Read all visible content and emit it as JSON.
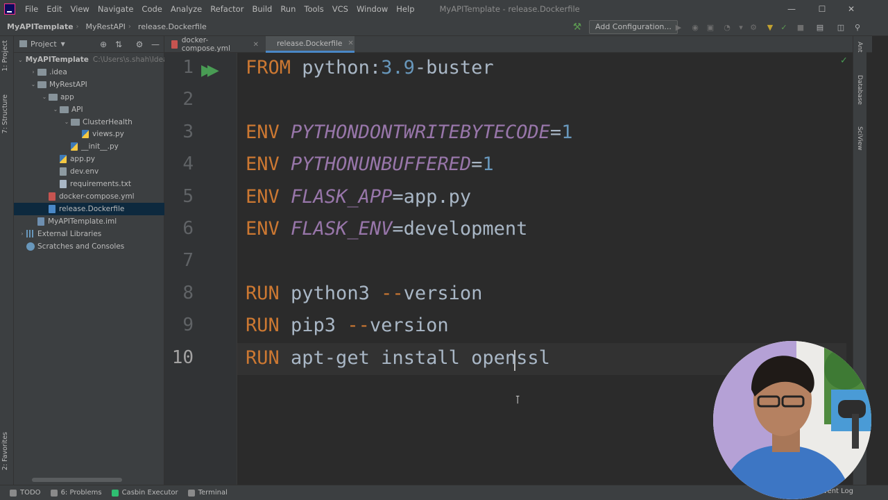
{
  "menu": {
    "items": [
      "File",
      "Edit",
      "View",
      "Navigate",
      "Code",
      "Analyze",
      "Refactor",
      "Build",
      "Run",
      "Tools",
      "VCS",
      "Window",
      "Help"
    ],
    "window_title": "MyAPITemplate - release.Dockerfile"
  },
  "breadcrumb": [
    "MyAPITemplate",
    "MyRestAPI",
    "release.Dockerfile"
  ],
  "toolbar": {
    "add_configuration": "Add Configuration..."
  },
  "left_strip": {
    "project_tab": "1: Project",
    "structure_tab": "7: Structure",
    "favorites_tab": "2: Favorites"
  },
  "right_strip": {
    "ant_tab": "Ant",
    "database_tab": "Database",
    "sciview_tab": "SciView"
  },
  "project_panel": {
    "title": "Project",
    "tree": [
      {
        "label": "MyAPITemplate",
        "hint": "C:\\Users\\s.shah\\Idea",
        "kind": "module",
        "depth": 0,
        "expanded": true
      },
      {
        "label": ".idea",
        "kind": "folder",
        "depth": 1,
        "expanded": false
      },
      {
        "label": "MyRestAPI",
        "kind": "folder",
        "depth": 1,
        "expanded": true
      },
      {
        "label": "app",
        "kind": "folder",
        "depth": 2,
        "expanded": true
      },
      {
        "label": "API",
        "kind": "folder",
        "depth": 3,
        "expanded": true
      },
      {
        "label": "ClusterHealth",
        "kind": "folder",
        "depth": 4,
        "expanded": true
      },
      {
        "label": "views.py",
        "kind": "py",
        "depth": 5
      },
      {
        "label": "__init__.py",
        "kind": "py",
        "depth": 4
      },
      {
        "label": "app.py",
        "kind": "py",
        "depth": 3
      },
      {
        "label": "dev.env",
        "kind": "env",
        "depth": 3
      },
      {
        "label": "requirements.txt",
        "kind": "txt",
        "depth": 3
      },
      {
        "label": "docker-compose.yml",
        "kind": "yml",
        "depth": 2
      },
      {
        "label": "release.Dockerfile",
        "kind": "docker",
        "depth": 2,
        "selected": true
      },
      {
        "label": "MyAPITemplate.iml",
        "kind": "iml",
        "depth": 1
      },
      {
        "label": "External Libraries",
        "kind": "lib",
        "depth": 0,
        "expanded": false
      },
      {
        "label": "Scratches and Consoles",
        "kind": "scratch",
        "depth": 0
      }
    ]
  },
  "tabs": [
    {
      "label": "docker-compose.yml",
      "active": false
    },
    {
      "label": "release.Dockerfile",
      "active": true
    }
  ],
  "editor": {
    "line_numbers": [
      "1",
      "2",
      "3",
      "4",
      "5",
      "6",
      "7",
      "8",
      "9",
      "10"
    ],
    "current_line": 10,
    "lines": [
      [
        {
          "t": "FROM",
          "c": "kw"
        },
        {
          "t": " python:",
          "c": "plain"
        },
        {
          "t": "3.9",
          "c": "num"
        },
        {
          "t": "-buster",
          "c": "plain"
        }
      ],
      [],
      [
        {
          "t": "ENV",
          "c": "kw"
        },
        {
          "t": " ",
          "c": "plain"
        },
        {
          "t": "PYTHONDONTWRITEBYTECODE",
          "c": "var"
        },
        {
          "t": "=",
          "c": "plain"
        },
        {
          "t": "1",
          "c": "num"
        }
      ],
      [
        {
          "t": "ENV",
          "c": "kw"
        },
        {
          "t": " ",
          "c": "plain"
        },
        {
          "t": "PYTHONUNBUFFERED",
          "c": "var"
        },
        {
          "t": "=",
          "c": "plain"
        },
        {
          "t": "1",
          "c": "num"
        }
      ],
      [
        {
          "t": "ENV",
          "c": "kw"
        },
        {
          "t": " ",
          "c": "plain"
        },
        {
          "t": "FLASK_APP",
          "c": "var"
        },
        {
          "t": "=app.py",
          "c": "plain"
        }
      ],
      [
        {
          "t": "ENV",
          "c": "kw"
        },
        {
          "t": " ",
          "c": "plain"
        },
        {
          "t": "FLASK_ENV",
          "c": "var"
        },
        {
          "t": "=development",
          "c": "plain"
        }
      ],
      [],
      [
        {
          "t": "RUN",
          "c": "kw"
        },
        {
          "t": " python3 ",
          "c": "plain"
        },
        {
          "t": "--",
          "c": "kw"
        },
        {
          "t": "version",
          "c": "plain"
        }
      ],
      [
        {
          "t": "RUN",
          "c": "kw"
        },
        {
          "t": " pip3 ",
          "c": "plain"
        },
        {
          "t": "--",
          "c": "kw"
        },
        {
          "t": "version",
          "c": "plain"
        }
      ],
      [
        {
          "t": "RUN",
          "c": "kw"
        },
        {
          "t": " apt-get install openssl",
          "c": "plain"
        }
      ]
    ]
  },
  "bottom_tools": [
    {
      "label": "TODO",
      "color": "#8a8a8a"
    },
    {
      "label": "6: Problems",
      "color": "#8a8a8a"
    },
    {
      "label": "Casbin Executor",
      "color": "#2fbf71"
    },
    {
      "label": "Terminal",
      "color": "#8a8a8a"
    }
  ],
  "status": {
    "event_log": "Event Log"
  }
}
